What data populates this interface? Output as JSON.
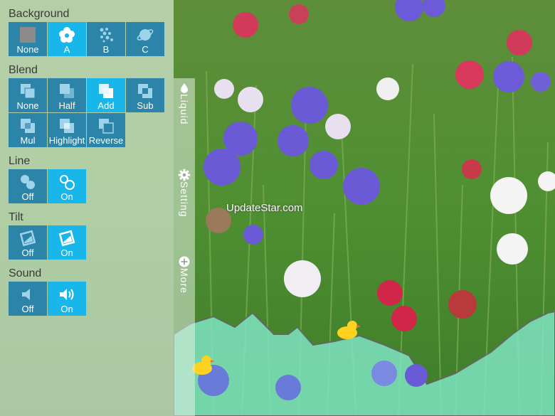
{
  "panel": {
    "sections": [
      {
        "title": "Background",
        "buttons": [
          "None",
          "A",
          "B",
          "C"
        ],
        "selected": "A"
      },
      {
        "title": "Blend",
        "buttons": [
          "None",
          "Half",
          "Add",
          "Sub",
          "Mul",
          "Highlight",
          "Reverse"
        ],
        "selected": "Add"
      },
      {
        "title": "Line",
        "buttons": [
          "Off",
          "On"
        ],
        "selected": "On"
      },
      {
        "title": "Tilt",
        "buttons": [
          "Off",
          "On"
        ],
        "selected": "On"
      },
      {
        "title": "Sound",
        "buttons": [
          "Off",
          "On"
        ],
        "selected": "On"
      }
    ]
  },
  "tabs": {
    "liquid": "Liquid",
    "setting": "Setting",
    "more": "More"
  },
  "watermark": "UpdateStar.com",
  "colors": {
    "button": "#2c84a8",
    "button_selected": "#19b6ea",
    "panel_bg": "#eef6ee",
    "liquid": "#7ee3c1"
  }
}
